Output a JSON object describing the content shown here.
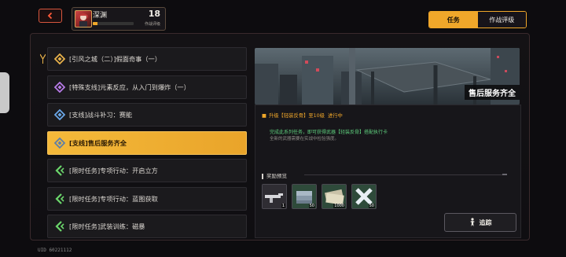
{
  "player": {
    "name": "深渊",
    "level": "18",
    "rank_label": "作战评级",
    "xp_fraction": 0.12
  },
  "tabs": {
    "active": "任务",
    "inactive": "作战评级"
  },
  "quests": [
    {
      "label": "[引风之城（二）]假面奇事（一）",
      "icon": "diamond-outline-icon",
      "color": "#e8b24a"
    },
    {
      "label": "[特殊支线]元素反应，从入门到爆炸（一）",
      "icon": "diamond-outline-icon",
      "color": "#b77be8"
    },
    {
      "label": "[支线]战斗补习：赛能",
      "icon": "diamond-outline-icon",
      "color": "#6aa7e8"
    },
    {
      "label": "[支线]售后服务齐全",
      "icon": "diamond-outline-icon",
      "color": "#5d86c4"
    },
    {
      "label": "[限时任务]专项行动：开启立方",
      "icon": "chevron-outline-icon",
      "color": "#6bd66b"
    },
    {
      "label": "[限时任务]专项行动：蓝图获取",
      "icon": "chevron-outline-icon",
      "color": "#6bd66b"
    },
    {
      "label": "[限时任务]武装训练：磁暴",
      "icon": "chevron-outline-icon",
      "color": "#6bd66b"
    }
  ],
  "detail": {
    "banner_title": "售后服务齐全",
    "objective": "升级【轻装反骨】至10级",
    "objective_status": "进行中",
    "desc_line1": "完成此系列任务，即可获得武器【轻装反骨】搭配执行卡",
    "desc_line2": "全新的武器需要在实战中检验强度。",
    "reward_label": "奖励预览",
    "rewards": [
      {
        "icon": "rifle-icon",
        "count": "1"
      },
      {
        "icon": "material-stack-icon",
        "count": "50"
      },
      {
        "icon": "credit-bills-icon",
        "count": "1000"
      },
      {
        "icon": "cross-tool-icon",
        "count": "50"
      }
    ],
    "track_label": "追踪"
  },
  "uid": "UID 60221112",
  "colors": {
    "accent": "#f0a72a",
    "danger": "#d8563d",
    "green_text": "#5fd07e"
  }
}
